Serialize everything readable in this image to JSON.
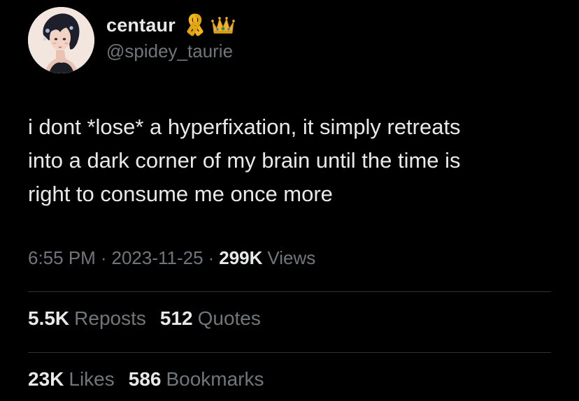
{
  "user": {
    "display_name": "centaur",
    "handle": "@spidey_taurie",
    "badges": [
      "ribbon-icon",
      "crown-icon"
    ],
    "avatar": "avatar"
  },
  "tweet": {
    "lines": [
      "i dont *lose* a hyperfixation, it simply retreats",
      "into a dark corner of my brain until the time is",
      "right to consume me once more"
    ]
  },
  "meta": {
    "time": "6:55 PM",
    "date": "2023-11-25",
    "separator": "·",
    "views_count": "299K",
    "views_label": "Views"
  },
  "stats": {
    "reposts_count": "5.5K",
    "reposts_label": "Reposts",
    "quotes_count": "512",
    "quotes_label": "Quotes",
    "likes_count": "23K",
    "likes_label": "Likes",
    "bookmarks_count": "586",
    "bookmarks_label": "Bookmarks"
  },
  "colors": {
    "background": "#000000",
    "primary_text": "#e7e9ea",
    "secondary_text": "#71767b",
    "divider": "#2f3336",
    "ribbon": "#f2b51c",
    "crown": "#f0b429"
  }
}
